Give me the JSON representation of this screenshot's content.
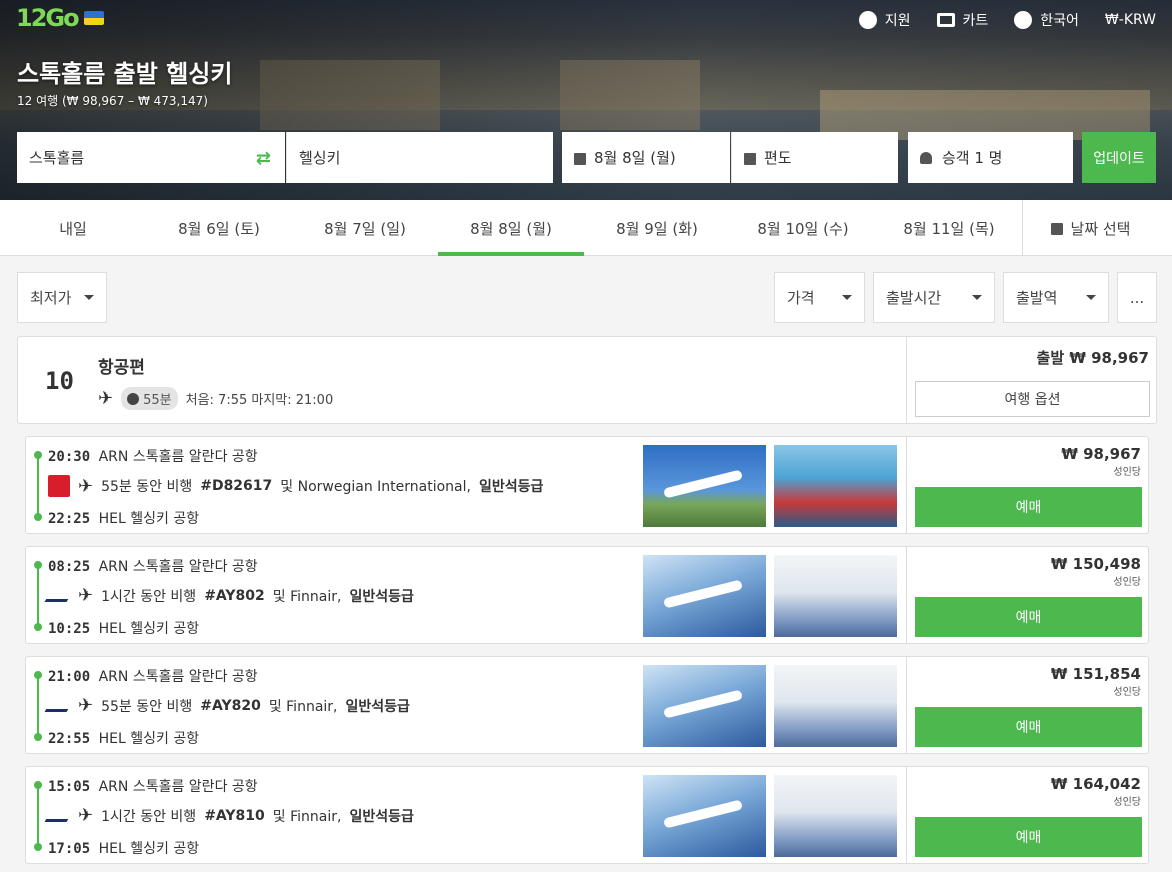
{
  "header": {
    "logo_text": "12Go",
    "nav": [
      {
        "icon": "lifebuoy-icon",
        "label": "지원"
      },
      {
        "icon": "cart-icon",
        "label": "카트"
      },
      {
        "icon": "globe-icon",
        "label": "한국어"
      },
      {
        "icon": "currency",
        "label": "₩-KRW"
      }
    ],
    "title": "스톡홀름 출발 헬싱키",
    "subtitle": "12 여행 (₩ 98,967 – ₩ 473,147)"
  },
  "search": {
    "from": "스톡홀름",
    "to": "헬싱키",
    "date": "8월 8일 (월)",
    "return": "편도",
    "passengers": "승객 1 명",
    "update_label": "업데이트"
  },
  "date_tabs": [
    {
      "label": "내일",
      "active": false
    },
    {
      "label": "8월 6일 (토)",
      "active": false
    },
    {
      "label": "8월 7일 (일)",
      "active": false
    },
    {
      "label": "8월 8일 (월)",
      "active": true
    },
    {
      "label": "8월 9일 (화)",
      "active": false
    },
    {
      "label": "8월 10일 (수)",
      "active": false
    },
    {
      "label": "8월 11일 (목)",
      "active": false
    }
  ],
  "date_pick_label": "날짜 선택",
  "filters": {
    "sort": "최저가",
    "price": "가격",
    "departure_time": "출발시간",
    "station": "출발역",
    "more": "..."
  },
  "summary": {
    "count": "10",
    "label": "항공편",
    "duration": "55분",
    "first_last": "처음: 7:55 마지막: 21:00",
    "from_price": "출발 ₩ 98,967",
    "options_label": "여행 옵션"
  },
  "results": [
    {
      "dep_time": "20:30",
      "dep_station": "ARN 스톡홀름 알란다 공항",
      "arr_time": "22:25",
      "arr_station": "HEL 헬싱키 공항",
      "duration_text": "55분 동안 비행",
      "flight_no": "#D82617",
      "airline": "및 Norwegian International,",
      "cabin": "일반석등급",
      "airline_key": "nor",
      "price": "₩ 98,967",
      "per": "성인당",
      "book_label": "예매"
    },
    {
      "dep_time": "08:25",
      "dep_station": "ARN 스톡홀름 알란다 공항",
      "arr_time": "10:25",
      "arr_station": "HEL 헬싱키 공항",
      "duration_text": "1시간 동안 비행",
      "flight_no": "#AY802",
      "airline": "및 Finnair,",
      "cabin": "일반석등급",
      "airline_key": "fin",
      "price": "₩ 150,498",
      "per": "성인당",
      "book_label": "예매"
    },
    {
      "dep_time": "21:00",
      "dep_station": "ARN 스톡홀름 알란다 공항",
      "arr_time": "22:55",
      "arr_station": "HEL 헬싱키 공항",
      "duration_text": "55분 동안 비행",
      "flight_no": "#AY820",
      "airline": "및 Finnair,",
      "cabin": "일반석등급",
      "airline_key": "fin",
      "price": "₩ 151,854",
      "per": "성인당",
      "book_label": "예매"
    },
    {
      "dep_time": "15:05",
      "dep_station": "ARN 스톡홀름 알란다 공항",
      "arr_time": "17:05",
      "arr_station": "HEL 헬싱키 공항",
      "duration_text": "1시간 동안 비행",
      "flight_no": "#AY810",
      "airline": "및 Finnair,",
      "cabin": "일반석등급",
      "airline_key": "fin",
      "price": "₩ 164,042",
      "per": "성인당",
      "book_label": "예매"
    }
  ],
  "colors": {
    "accent": "#4cb84e"
  }
}
